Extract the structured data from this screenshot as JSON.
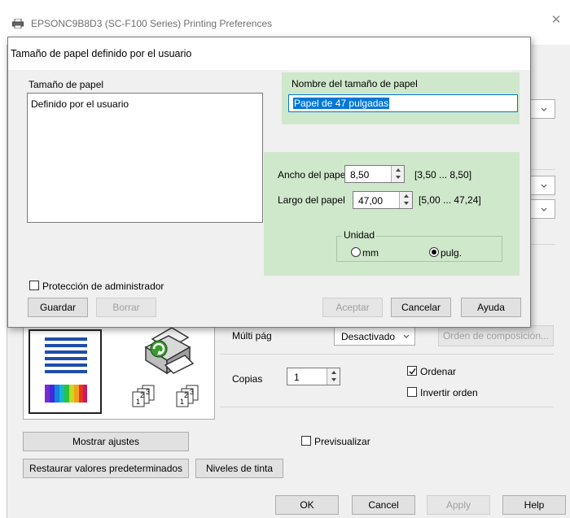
{
  "window": {
    "title": "EPSONC9B8D3 (SC-F100 Series) Printing Preferences",
    "close_glyph": "✕"
  },
  "dialog": {
    "title": "Tamaño de papel definido por el usuario",
    "paper_size_label": "Tamaño de papel",
    "paper_size_items": [
      "Definido por el usuario"
    ],
    "name_label": "Nombre del tamaño de papel",
    "name_value": "Papel de 47 pulgadas",
    "width_label": "Ancho del papel",
    "width_value": "8,50",
    "width_range": "[3,50 ... 8,50]",
    "length_label": "Largo del papel",
    "length_value": "47,00",
    "length_range": "[5,00 ... 47,24]",
    "unit_label": "Unidad",
    "unit_mm": "mm",
    "unit_inch": "pulg.",
    "admin_label": "Protección de administrador",
    "save_label": "Guardar",
    "delete_label": "Borrar",
    "accept_label": "Aceptar",
    "cancel_label": "Cancelar",
    "help_label": "Ayuda",
    "accent_green": "#cfe8cb",
    "selection_blue": "#0078d7"
  },
  "main": {
    "multipage_label": "Múlti pág",
    "multipage_value": "Desactivado",
    "layout_order_label": "Orden de composición...",
    "copies_label": "Copias",
    "copies_value": "1",
    "collate_label": "Ordenar",
    "reverse_label": "Invertir orden",
    "show_settings_label": "Mostrar ajustes",
    "preview_label": "Previsualizar",
    "restore_defaults_label": "Restaurar valores predeterminados",
    "ink_levels_label": "Niveles de tinta",
    "copies_icons": [
      "1",
      "2",
      "3"
    ]
  },
  "footer": {
    "ok_label": "OK",
    "cancel_label": "Cancel",
    "apply_label": "Apply",
    "help_label": "Help"
  }
}
